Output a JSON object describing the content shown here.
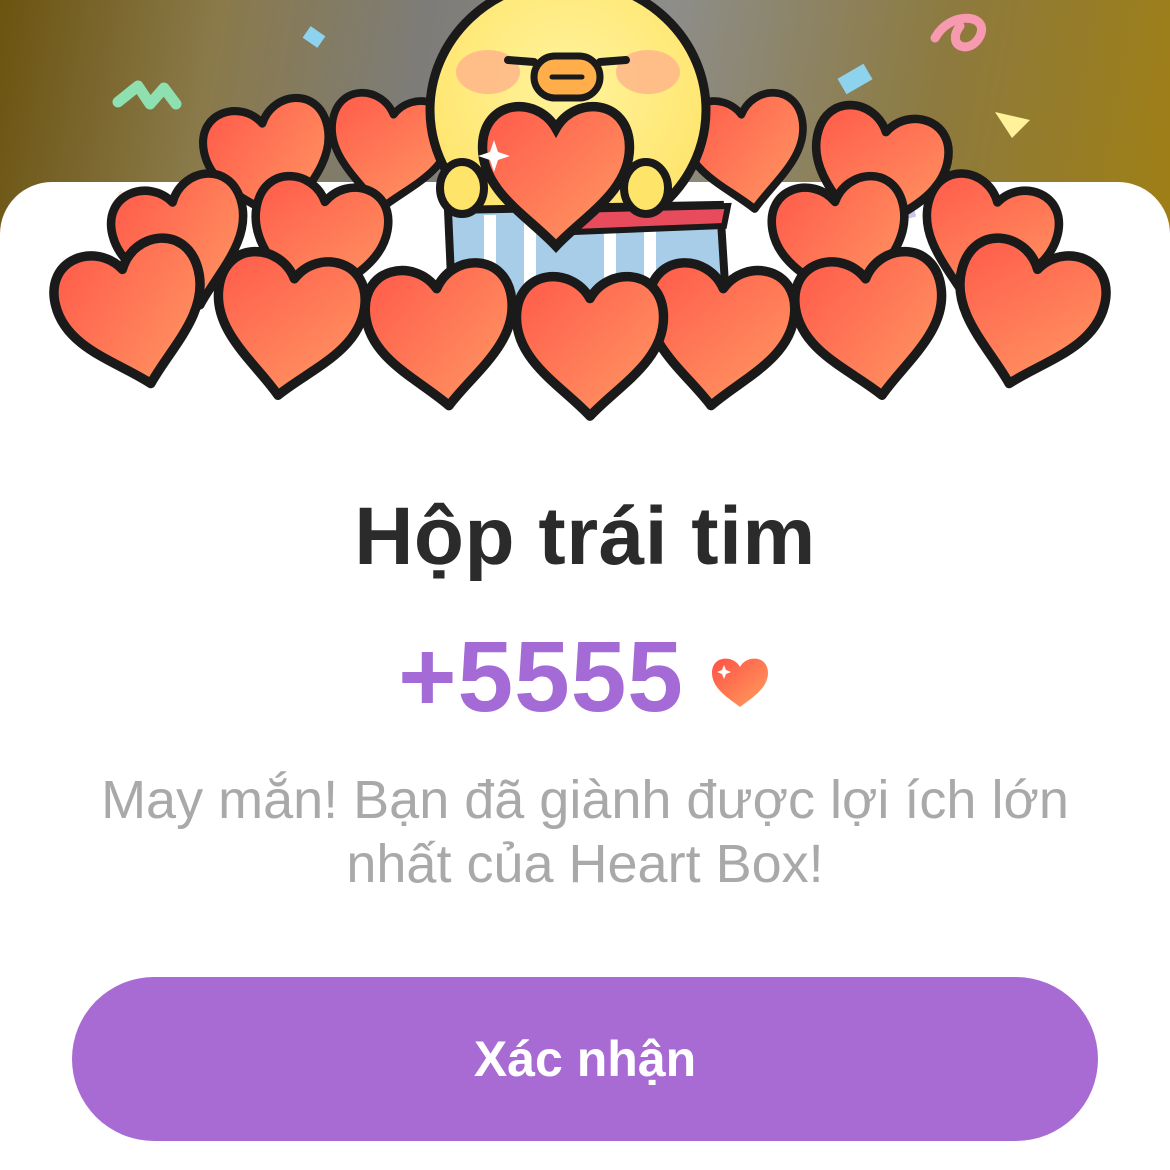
{
  "dialog": {
    "title": "Hộp trái tim",
    "reward_amount": "+5555",
    "reward_icon": "heart-icon",
    "message": "May mắn! Bạn đã giành được lợi ích lớn nhất của Heart Box!",
    "confirm_label": "Xác nhận"
  },
  "colors": {
    "accent": "#a86bd4",
    "amount": "#a46ad6",
    "title": "#2b2b2b",
    "message": "#a9a9a9",
    "heart_fill": "#ff6a4f"
  }
}
